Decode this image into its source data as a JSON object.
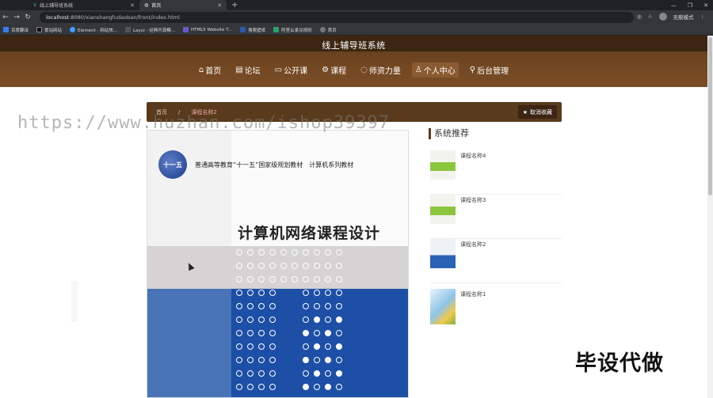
{
  "browser": {
    "tabs": [
      {
        "label": "线上辅导班系统",
        "active": false
      },
      {
        "label": "首页",
        "active": true
      }
    ],
    "url_host": "localhost",
    "url_rest": ":8080/xianshangfudaoban/front/index.html",
    "profile_label": "无痕模式",
    "bookmarks": [
      "百度翻译",
      "爱站网站",
      "Element - 网站快...",
      "Layui - 经典开源模...",
      "HTML5 Website T...",
      "搜索壁纸",
      "阿里云承兑规则",
      "首页"
    ]
  },
  "site": {
    "title": "线上辅导班系统",
    "nav": [
      {
        "label": "首页",
        "icon": "home-icon"
      },
      {
        "label": "论坛",
        "icon": "forum-icon"
      },
      {
        "label": "公开课",
        "icon": "video-icon"
      },
      {
        "label": "课程",
        "icon": "gear-icon"
      },
      {
        "label": "师资力量",
        "icon": "teacher-icon"
      },
      {
        "label": "个人中心",
        "icon": "user-icon",
        "active": true
      },
      {
        "label": "后台管理",
        "icon": "link-icon"
      }
    ]
  },
  "breadcrumb": {
    "home": "首页",
    "sep": "/",
    "current": "课程名称2"
  },
  "favorite_button": "取消收藏",
  "watermark": "https://www.huzhan.com/ishop39397",
  "book": {
    "logo_text": "十一五",
    "series": "普通高等教育“十一五”国家级规划教材　计算机系列教材",
    "title": "计算机网络课程设计"
  },
  "sidebar": {
    "title": "系统推荐",
    "items": [
      {
        "name": "课程名称4"
      },
      {
        "name": "课程名称3"
      },
      {
        "name": "课程名称2"
      },
      {
        "name": "课程名称1"
      }
    ]
  },
  "brand_watermark": "毕设代做",
  "colors": {
    "header": "#6e4521",
    "crumb": "#5a3a1c",
    "book_blue": "#1d4fa6"
  }
}
